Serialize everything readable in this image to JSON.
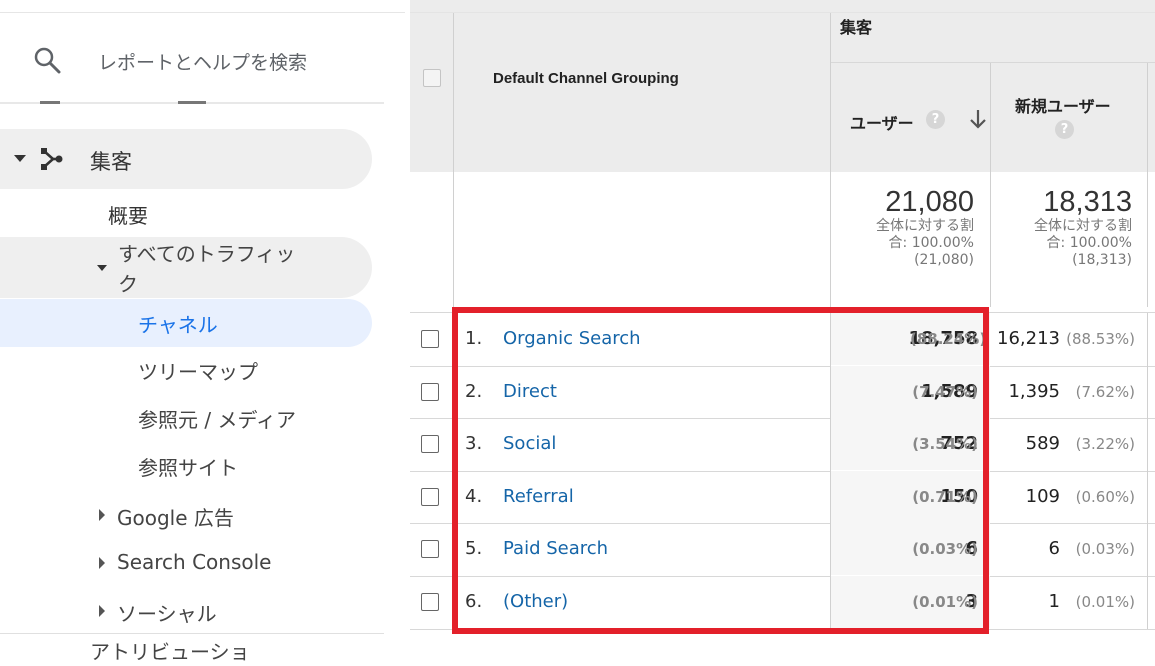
{
  "sidebar": {
    "search_placeholder": "レポートとヘルプを検索",
    "acquisition_label": "集客",
    "overview_label": "概要",
    "all_traffic_label": "すべてのトラフィック",
    "channels_label": "チャネル",
    "treemaps_label": "ツリーマップ",
    "source_medium_label": "参照元 / メディア",
    "referrals_label": "参照サイト",
    "google_ads_label": "Google 広告",
    "search_console_label": "Search Console",
    "social_label": "ソーシャル",
    "attribution_label": "アトリビューショ"
  },
  "table": {
    "dimension_header": "Default Channel Grouping",
    "group_header": "集客",
    "users_header": "ユーザー",
    "new_users_header": "新規ユーザー",
    "help_glyph": "?",
    "totals": {
      "users": "21,080",
      "users_pct_line1": "全体に対する割",
      "users_pct_line2": "合: 100.00%",
      "users_pct_line3": "(21,080)",
      "new_users": "18,313",
      "new_users_pct_line1": "全体に対する割",
      "new_users_pct_line2": "合: 100.00%",
      "new_users_pct_line3": "(18,313)"
    },
    "rows": [
      {
        "num": "1.",
        "channel": "Organic Search",
        "users": "18,758",
        "users_pct": "(88.24%)",
        "new_users": "16,213",
        "new_users_pct": "(88.53%)"
      },
      {
        "num": "2.",
        "channel": "Direct",
        "users": "1,589",
        "users_pct": "(7.47%)",
        "new_users": "1,395",
        "new_users_pct": "(7.62%)"
      },
      {
        "num": "3.",
        "channel": "Social",
        "users": "752",
        "users_pct": "(3.54%)",
        "new_users": "589",
        "new_users_pct": "(3.22%)"
      },
      {
        "num": "4.",
        "channel": "Referral",
        "users": "150",
        "users_pct": "(0.71%)",
        "new_users": "109",
        "new_users_pct": "(0.60%)"
      },
      {
        "num": "5.",
        "channel": "Paid Search",
        "users": "6",
        "users_pct": "(0.03%)",
        "new_users": "6",
        "new_users_pct": "(0.03%)"
      },
      {
        "num": "6.",
        "channel": "(Other)",
        "users": "3",
        "users_pct": "(0.01%)",
        "new_users": "1",
        "new_users_pct": "(0.01%)"
      }
    ]
  },
  "colors": {
    "highlight_border": "#e3202a",
    "link": "#1565a8",
    "active_nav_bg": "#e8f0fe",
    "active_nav_text": "#1a73e8"
  }
}
